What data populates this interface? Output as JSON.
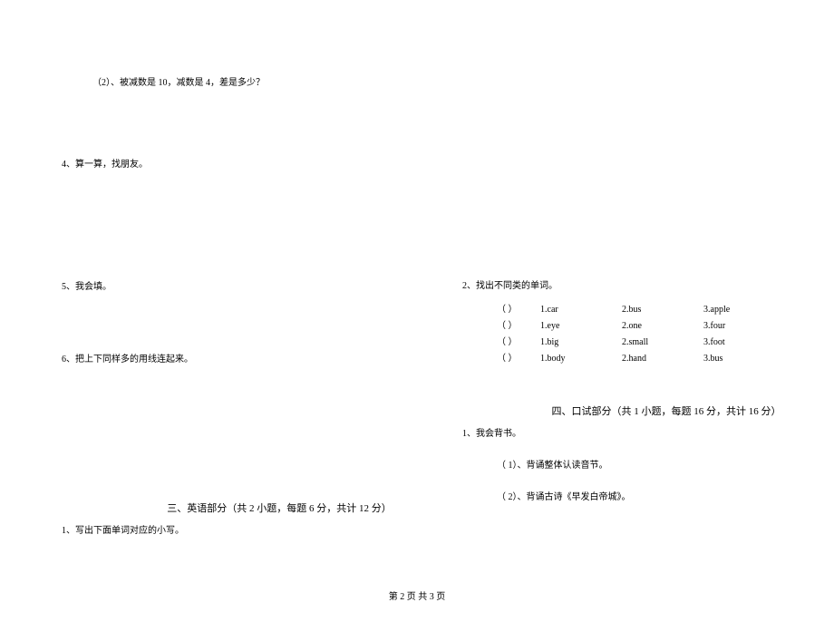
{
  "left": {
    "q_sub": "（2）、被减数是 10，减数是 4，差是多少？",
    "q4": "4、算一算，找朋友。",
    "q5": "5、我会填。",
    "q6": "6、把上下同样多的用线连起来。",
    "section3_header": "三、英语部分（共 2 小题，每题 6 分，共计 12 分）",
    "q3_1": "1、写出下面单词对应的小写。"
  },
  "right": {
    "q2": "2、找出不同类的单词。",
    "rows": [
      {
        "p": "（    ）",
        "c1": "1.car",
        "c2": "2.bus",
        "c3": "3.apple"
      },
      {
        "p": "（    ）",
        "c1": "1.eye",
        "c2": "2.one",
        "c3": "3.four"
      },
      {
        "p": "（    ）",
        "c1": "1.big",
        "c2": "2.small",
        "c3": "3.foot"
      },
      {
        "p": "（    ）",
        "c1": "1.body",
        "c2": "2.hand",
        "c3": "3.bus"
      }
    ],
    "section4_header": "四、口试部分（共 1 小题，每题 16 分，共计 16 分）",
    "q4_1": "1、我会背书。",
    "q4_1_1": "（ 1）、背诵整体认读音节。",
    "q4_1_2": "（ 2）、背诵古诗《早发白帝城》。"
  },
  "footer": "第 2 页    共 3 页"
}
